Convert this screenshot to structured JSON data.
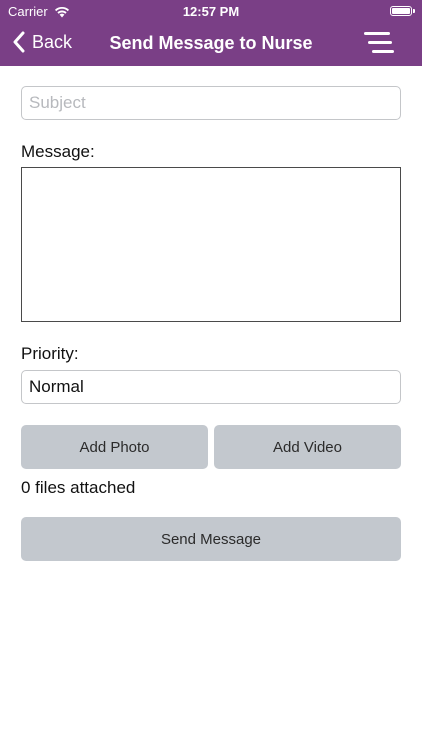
{
  "status_bar": {
    "carrier": "Carrier",
    "time": "12:57 PM"
  },
  "nav": {
    "back_label": "Back",
    "title": "Send Message to Nurse"
  },
  "form": {
    "subject_placeholder": "Subject",
    "message_label": "Message:",
    "message_value": "",
    "priority_label": "Priority:",
    "priority_value": "Normal"
  },
  "buttons": {
    "add_photo": "Add Photo",
    "add_video": "Add Video",
    "send_message": "Send Message"
  },
  "attachments_text": "0 files attached",
  "colors": {
    "header": "#7a3f86",
    "button_bg": "#c3c8ce"
  }
}
